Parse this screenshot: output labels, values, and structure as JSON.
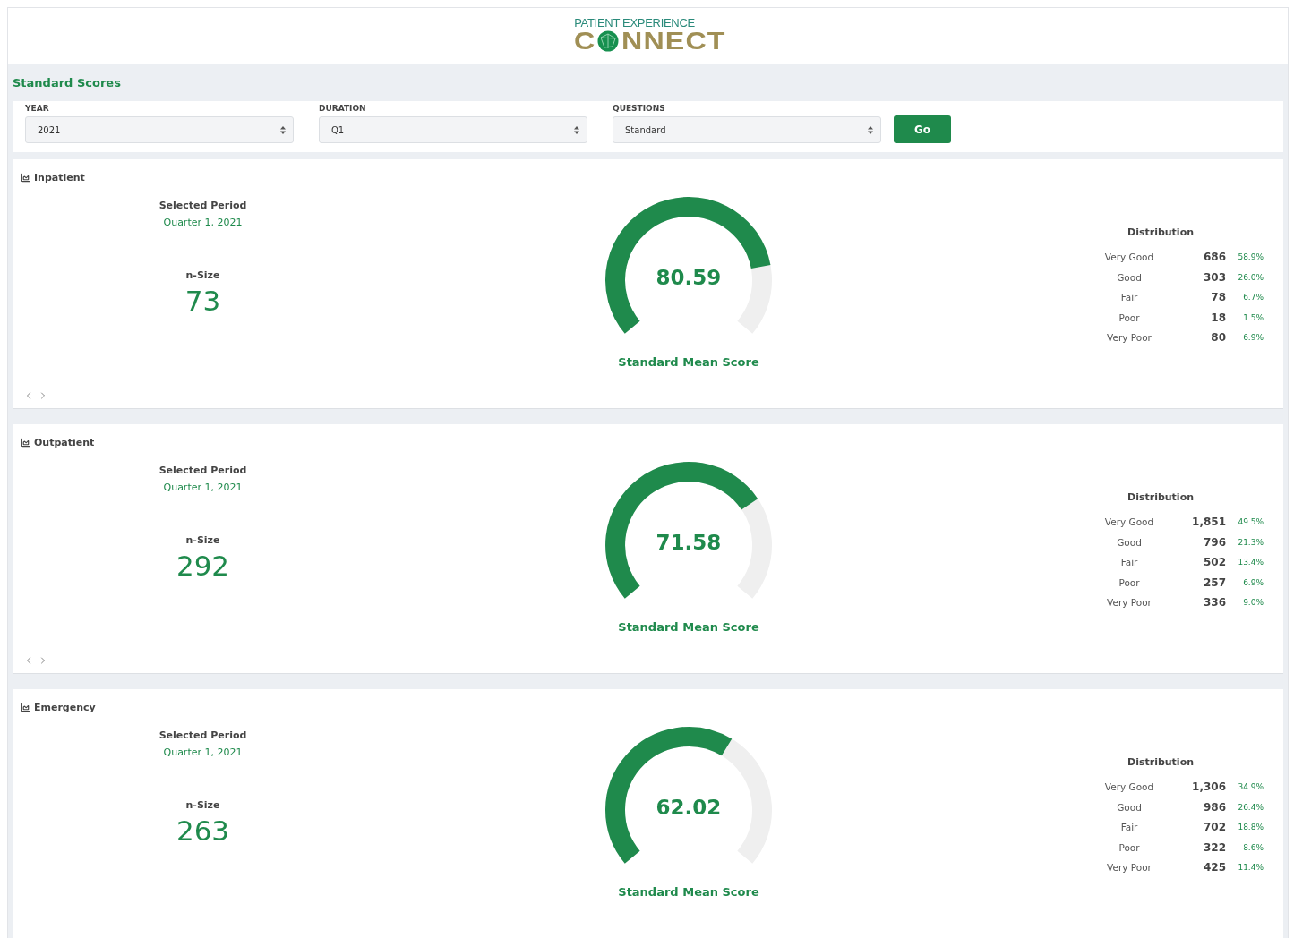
{
  "logo": {
    "tagline": "PATIENT EXPERIENCE",
    "word_start": "C",
    "word_end": "NNECT"
  },
  "page_title": "Standard Scores",
  "filters": [
    {
      "label": "YEAR",
      "value": "2021"
    },
    {
      "label": "DURATION",
      "value": "Q1"
    },
    {
      "label": "QUESTIONS",
      "value": "Standard"
    }
  ],
  "go_button": "Go",
  "panels": [
    {
      "title": "Inpatient",
      "period_label": "Selected Period",
      "period": "Quarter 1, 2021",
      "nsize_label": "n-Size",
      "nsize": "73",
      "gauge": {
        "value": "80.59",
        "label": "Standard Mean Score"
      },
      "pager": true,
      "distribution": {
        "title": "Distribution",
        "rows": [
          {
            "label": "Very Good",
            "count": "686",
            "percent": "58.9%"
          },
          {
            "label": "Good",
            "count": "303",
            "percent": "26.0%"
          },
          {
            "label": "Fair",
            "count": "78",
            "percent": "6.7%"
          },
          {
            "label": "Poor",
            "count": "18",
            "percent": "1.5%"
          },
          {
            "label": "Very Poor",
            "count": "80",
            "percent": "6.9%"
          }
        ]
      }
    },
    {
      "title": "Outpatient",
      "period_label": "Selected Period",
      "period": "Quarter 1, 2021",
      "nsize_label": "n-Size",
      "nsize": "292",
      "gauge": {
        "value": "71.58",
        "label": "Standard Mean Score"
      },
      "pager": true,
      "distribution": {
        "title": "Distribution",
        "rows": [
          {
            "label": "Very Good",
            "count": "1,851",
            "percent": "49.5%"
          },
          {
            "label": "Good",
            "count": "796",
            "percent": "21.3%"
          },
          {
            "label": "Fair",
            "count": "502",
            "percent": "13.4%"
          },
          {
            "label": "Poor",
            "count": "257",
            "percent": "6.9%"
          },
          {
            "label": "Very Poor",
            "count": "336",
            "percent": "9.0%"
          }
        ]
      }
    },
    {
      "title": "Emergency",
      "period_label": "Selected Period",
      "period": "Quarter 1, 2021",
      "nsize_label": "n-Size",
      "nsize": "263",
      "gauge": {
        "value": "62.02",
        "label": "Standard Mean Score"
      },
      "pager": false,
      "distribution": {
        "title": "Distribution",
        "rows": [
          {
            "label": "Very Good",
            "count": "1,306",
            "percent": "34.9%"
          },
          {
            "label": "Good",
            "count": "986",
            "percent": "26.4%"
          },
          {
            "label": "Fair",
            "count": "702",
            "percent": "18.8%"
          },
          {
            "label": "Poor",
            "count": "322",
            "percent": "8.6%"
          },
          {
            "label": "Very Poor",
            "count": "425",
            "percent": "11.4%"
          }
        ]
      }
    }
  ]
}
